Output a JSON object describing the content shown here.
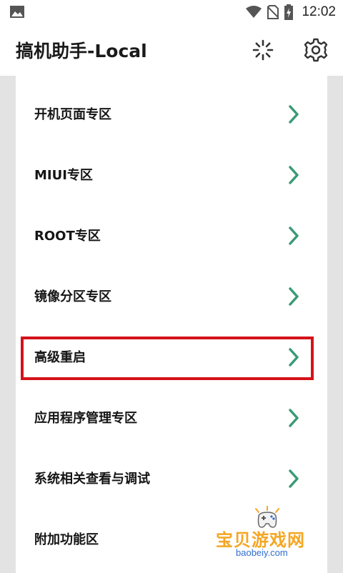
{
  "status_bar": {
    "time": "12:02",
    "icons": [
      "image-icon",
      "wifi-icon",
      "no-sim-icon",
      "battery-charging-icon"
    ]
  },
  "app_bar": {
    "title": "搞机助手-Local",
    "actions": [
      "loading-spinner-icon",
      "gear-icon"
    ]
  },
  "menu": {
    "items": [
      {
        "label": "开机页面专区"
      },
      {
        "label": "MIUI专区"
      },
      {
        "label": "ROOT专区"
      },
      {
        "label": "镜像分区专区"
      },
      {
        "label": "高级重启",
        "highlighted": true
      },
      {
        "label": "应用程序管理专区"
      },
      {
        "label": "系统相关查看与调试"
      },
      {
        "label": "附加功能区"
      }
    ],
    "chevron_color": "#3a9a76"
  },
  "highlight": {
    "color": "#d4121a"
  },
  "watermark": {
    "text": "宝贝游戏网",
    "url": "baobeiy.com"
  }
}
